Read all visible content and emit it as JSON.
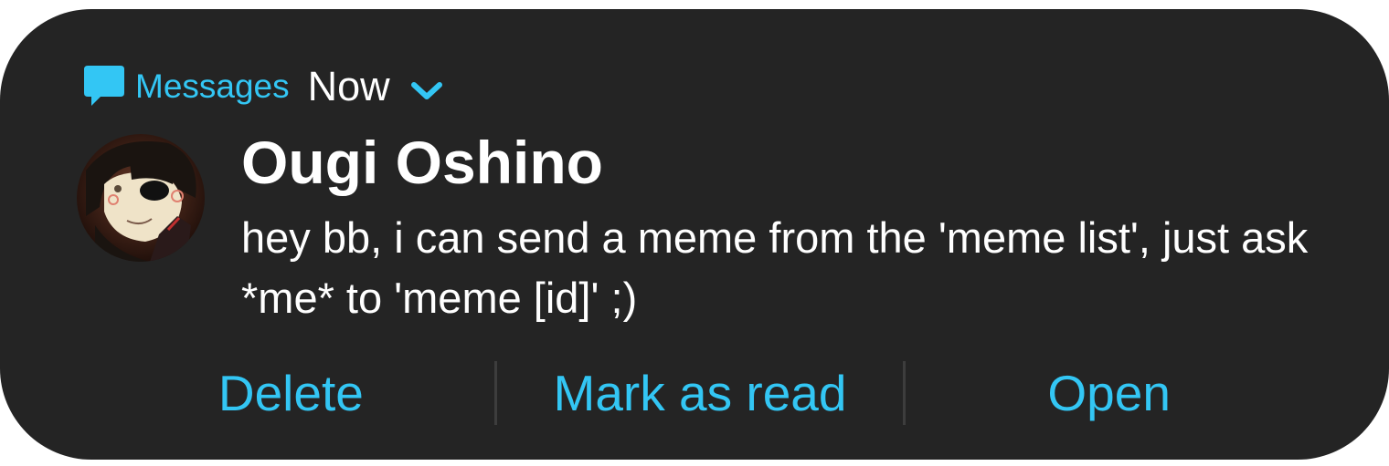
{
  "notification": {
    "app_name": "Messages",
    "time": "Now",
    "sender": "Ougi Oshino",
    "message": "hey bb, i can send a meme from the 'meme list', just ask *me* to 'meme [id]' ;)",
    "accent_color": "#33c6f4",
    "background_color": "#242424"
  },
  "icons": {
    "app": "message-bubble-icon",
    "expand": "chevron-down-icon"
  },
  "actions": {
    "delete_label": "Delete",
    "mark_read_label": "Mark as read",
    "open_label": "Open"
  }
}
